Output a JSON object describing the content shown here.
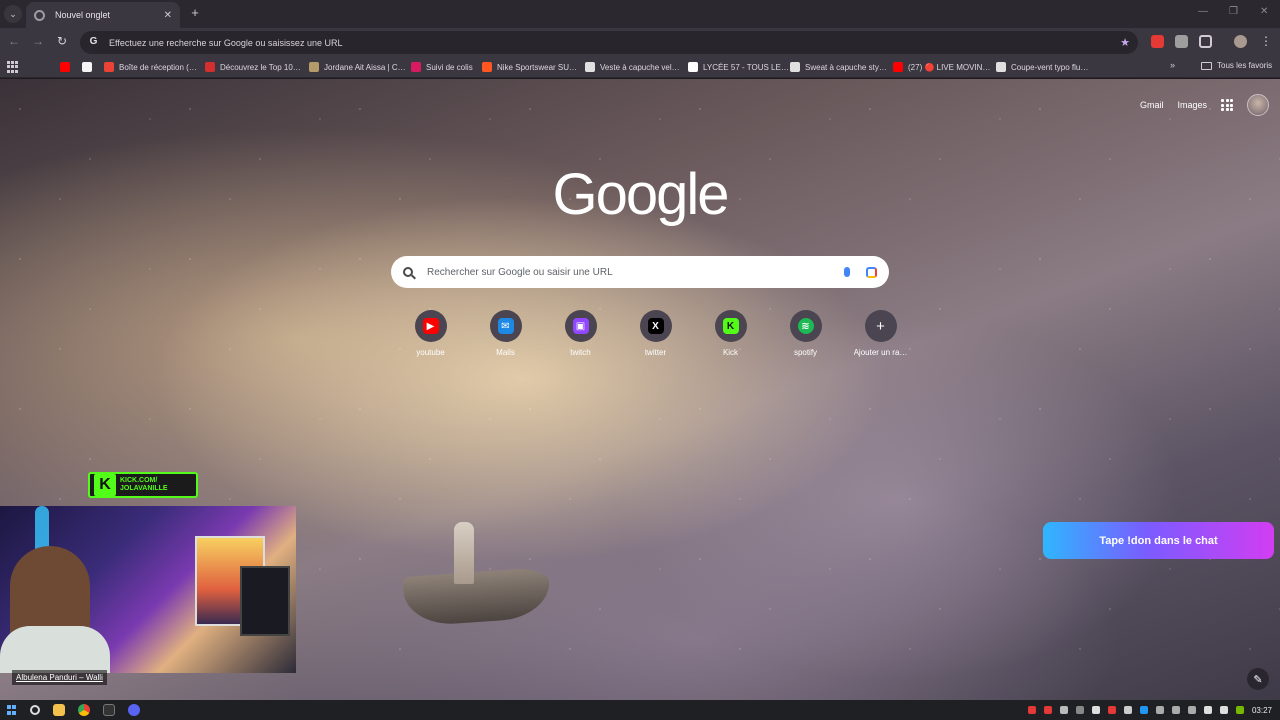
{
  "tab": {
    "title": "Nouvel onglet"
  },
  "omnibox": {
    "placeholder": "Effectuez une recherche sur Google ou saisissez une URL"
  },
  "bookmarks": {
    "items": [
      {
        "label": "Boîte de réception (…",
        "icon_color": "#ea4335"
      },
      {
        "label": "Découvrez le Top 10…",
        "icon_color": "#d32f2f"
      },
      {
        "label": "Jordane Ait Aissa | C…",
        "icon_color": "#b39b6a"
      },
      {
        "label": "Suivi de colis",
        "icon_color": "#d81b60"
      },
      {
        "label": "Nike Sportswear SU…",
        "icon_color": "#ff5722"
      },
      {
        "label": "Veste à capuche vel…",
        "icon_color": "#e0e0e0"
      },
      {
        "label": "LYCÉE 57 - TOUS LE…",
        "icon_color": "#ffffff"
      },
      {
        "label": "Sweat à capuche sty…",
        "icon_color": "#e0e0e0"
      },
      {
        "label": "(27) 🔴 LIVE MOVIN…",
        "icon_color": "#ff0000"
      },
      {
        "label": "Coupe-vent typo flu…",
        "icon_color": "#e0e0e0"
      }
    ],
    "all_label": "Tous les favoris"
  },
  "ntp": {
    "gmail_label": "Gmail",
    "images_label": "Images",
    "logo_text": "Google",
    "search_placeholder": "Rechercher sur Google ou saisir une URL",
    "shortcuts": [
      {
        "label": "youtube",
        "icon": "youtube-icon",
        "color": "#ff0000",
        "glyph": "▶"
      },
      {
        "label": "Mails",
        "icon": "mail-icon",
        "color": "#1e88e5",
        "glyph": "✉"
      },
      {
        "label": "twitch",
        "icon": "twitch-icon",
        "color": "#9146ff",
        "glyph": "▣"
      },
      {
        "label": "twitter",
        "icon": "x-icon",
        "color": "#000000",
        "glyph": "X"
      },
      {
        "label": "Kick",
        "icon": "kick-icon",
        "color": "#53fc18",
        "glyph": "K"
      },
      {
        "label": "spotify",
        "icon": "spotify-icon",
        "color": "#1db954",
        "glyph": "≋"
      },
      {
        "label": "Ajouter un ra…",
        "icon": "add-icon",
        "color": "#4a4550",
        "glyph": "+"
      }
    ]
  },
  "overlay": {
    "kick_line1": "KICK.COM/",
    "kick_line2": "JOLAVANILLE",
    "song_label": "Albulena Panduri – Walli",
    "don_banner": "Tape !don dans le chat"
  },
  "taskbar": {
    "time": "03:27"
  }
}
